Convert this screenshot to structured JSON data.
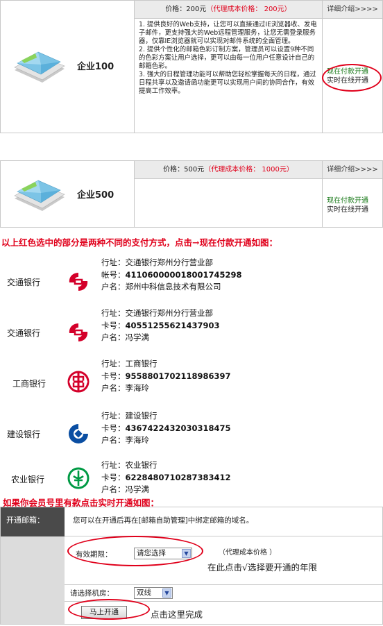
{
  "products": [
    {
      "name": "企业100",
      "price_label": "价格：200元",
      "cost_text": "（代理成本价格： 200元）",
      "detail_link": "详细介绍>>>>",
      "features": [
        "1. 提供良好的Web支持，让您可以直接通过IE浏览器收、发电子邮件，更支持强大的Web远程管理服务，让您无需登录服务器，仅靠IE浏览器就可以实现对邮件系统的全面管理。",
        "2. 提供个性化的邮箱色彩订制方案，管理员可以设置9种不同的色彩方案让用户选择，更可以由每一位用户任意设计自己的邮箱色彩。",
        "3. 强大的日程管理功能可以帮助您轻松掌握每天的日程，通过日程共享以及邀请函功能更可以实现用户间的协同合作，有效提高工作效率。"
      ],
      "pay_now": "现在付款开通",
      "pay_online": "实时在线开通"
    },
    {
      "name": "企业500",
      "price_label": "价格：500元",
      "cost_text": "（代理成本价格： 1000元）",
      "detail_link": "详细介绍>>>>",
      "pay_now": "现在付款开通",
      "pay_online": "实时在线开通"
    }
  ],
  "note_payment": "以上红色选中的部分是两种不同的支付方式，点击→现在付款开通如图：",
  "banks": [
    {
      "name": "交通银行",
      "logo": "bocom-logo-icon",
      "lines": [
        {
          "k": "行址：",
          "v": "交通银行郑州分行营业部",
          "bold": false
        },
        {
          "k": "帐号：",
          "v": "411060000018001745298",
          "bold": true
        },
        {
          "k": "户名：",
          "v": "郑州中科信息技术有限公司",
          "bold": false
        }
      ]
    },
    {
      "name": "交通银行",
      "logo": "bocom-logo-icon",
      "lines": [
        {
          "k": "行址：",
          "v": "交通银行郑州分行营业部",
          "bold": false
        },
        {
          "k": "卡号：",
          "v": "40551255621437903",
          "bold": true
        },
        {
          "k": "户名：",
          "v": "冯学满",
          "bold": false
        }
      ]
    },
    {
      "name": "工商银行",
      "logo": "icbc-logo-icon",
      "lines": [
        {
          "k": "行址：",
          "v": "工商银行",
          "bold": false
        },
        {
          "k": "卡号：",
          "v": "9558801702118986397",
          "bold": true
        },
        {
          "k": "户名：",
          "v": "李海玲",
          "bold": false
        }
      ]
    },
    {
      "name": "建设银行",
      "logo": "ccb-logo-icon",
      "lines": [
        {
          "k": "行址：",
          "v": "建设银行",
          "bold": false
        },
        {
          "k": "卡号：",
          "v": "4367422432030318475",
          "bold": true
        },
        {
          "k": "户名：",
          "v": "李海玲",
          "bold": false
        }
      ]
    },
    {
      "name": "农业银行",
      "logo": "abc-logo-icon",
      "lines": [
        {
          "k": "行址：",
          "v": "农业银行",
          "bold": false
        },
        {
          "k": "卡号：",
          "v": "6228480710287383412",
          "bold": true
        },
        {
          "k": "户名：",
          "v": "冯学满",
          "bold": false
        }
      ]
    }
  ],
  "note_realtime": "如果你会员号里有款点击实时开通如图：",
  "form": {
    "header_label": "开通邮箱：",
    "header_text": "您可以在开通后再在[邮箱自助管理]中绑定邮箱的域名。",
    "period_label": "有效期限：",
    "period_value": "请您选择",
    "cost_note": "（代理成本价格 ）",
    "period_hint": "在此点击√选择要开通的年限",
    "room_label": "请选择机房：",
    "room_value": "双线",
    "submit_label": "马上开通",
    "submit_hint": "点击这里完成"
  },
  "colors": {
    "annotation_red": "#e0001b",
    "pay_green": "#1a7a1a",
    "header_gray": "#ebebeb",
    "form_label_dark": "#4a4a4a"
  }
}
